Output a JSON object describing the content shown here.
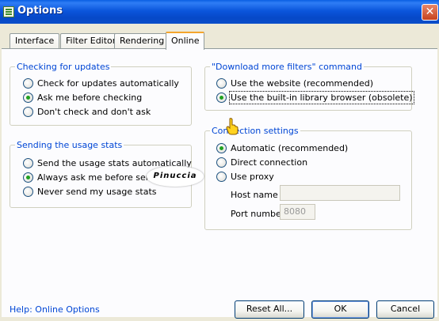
{
  "window": {
    "title": "Options"
  },
  "tabs": [
    {
      "label": "Interface"
    },
    {
      "label": "Filter Editor"
    },
    {
      "label": "Rendering"
    },
    {
      "label": "Online",
      "active": true
    }
  ],
  "updates": {
    "title": "Checking for updates",
    "options": [
      {
        "label": "Check for updates automatically",
        "selected": false
      },
      {
        "label": "Ask me before checking",
        "selected": true
      },
      {
        "label": "Don't check and don't ask",
        "selected": false
      }
    ]
  },
  "usage": {
    "title": "Sending the usage stats",
    "options": [
      {
        "label": "Send the usage stats automatically",
        "selected": false
      },
      {
        "label": "Always ask me before sending",
        "selected": true
      },
      {
        "label": "Never send my usage stats",
        "selected": false
      }
    ]
  },
  "download": {
    "title": "\"Download more filters\" command",
    "options": [
      {
        "label": "Use the website (recommended)",
        "selected": false
      },
      {
        "label": "Use the built-in library browser (obsolete)",
        "selected": true
      }
    ]
  },
  "connection": {
    "title": "Connection settings",
    "options": [
      {
        "label": "Automatic (recommended)",
        "selected": true
      },
      {
        "label": "Direct connection",
        "selected": false
      },
      {
        "label": "Use proxy",
        "selected": false
      }
    ],
    "host_label": "Host name",
    "host_value": "",
    "port_label": "Port number",
    "port_value": "8080"
  },
  "watermark": "Pinuccia",
  "footer": {
    "help_link": "Help: Online Options",
    "reset_label": "Reset All...",
    "ok_label": "OK",
    "cancel_label": "Cancel"
  },
  "colors": {
    "titlebar": "#0a56dc",
    "group_title": "#0046d5",
    "radio_selected": "#21a121",
    "tab_highlight": "#f4a52c"
  }
}
